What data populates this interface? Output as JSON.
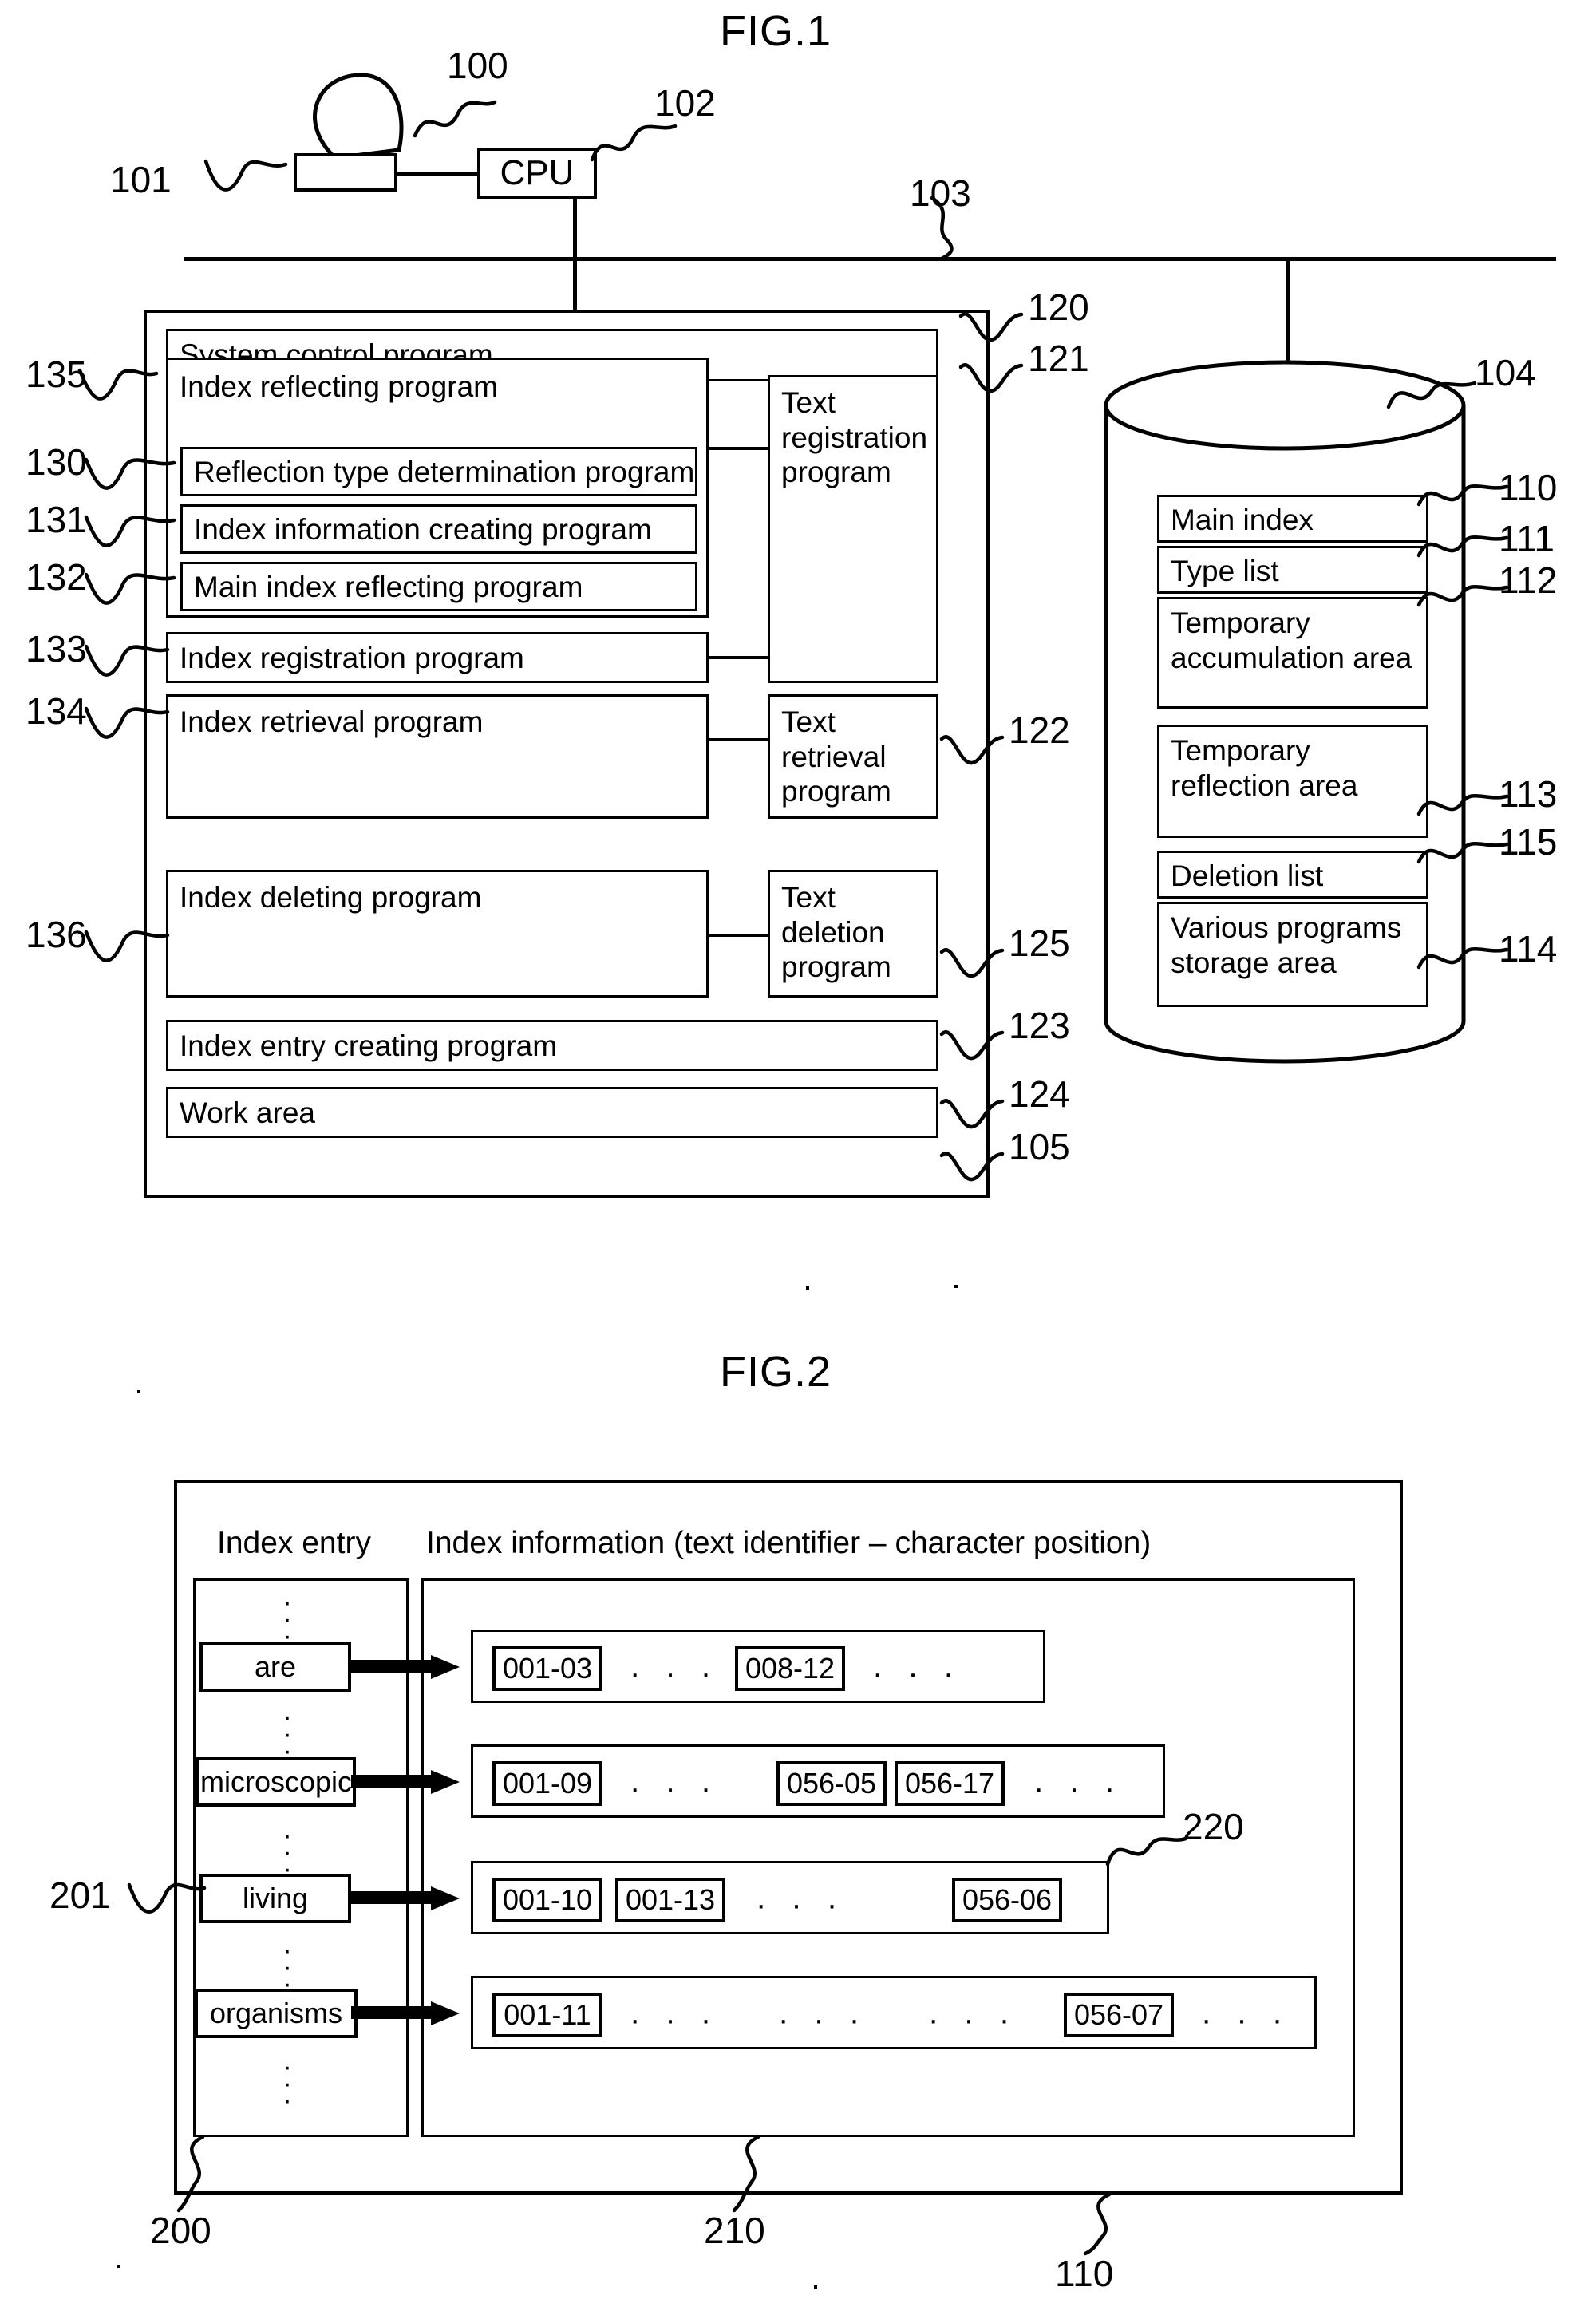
{
  "figures": [
    {
      "id": "fig1",
      "title": "FIG.1",
      "cpu_label": "CPU",
      "memory_blocks": {
        "system_control": "System control program",
        "index_reflecting": "Index reflecting program",
        "reflection_type": "Reflection type determination program",
        "index_info_creating": "Index information creating program",
        "main_index_reflecting": "Main index reflecting program",
        "index_registration": "Index registration program",
        "index_retrieval": "Index retrieval program",
        "index_deleting": "Index deleting program",
        "index_entry_creating": "Index entry creating program",
        "work_area": "Work area",
        "text_registration": "Text\nregistration\nprogram",
        "text_retrieval": "Text\nretrieval\nprogram",
        "text_deletion": "Text\ndeletion\nprogram"
      },
      "storage_blocks": {
        "main_index": "Main index",
        "type_list": "Type list",
        "temporary_accumulation": "Temporary\naccumulation area",
        "temporary_reflection": "Temporary\nreflection area",
        "deletion_list": "Deletion list",
        "various_programs": "Various programs\n storage area"
      },
      "reference_numerals": {
        "display": "100",
        "input_device": "101",
        "cpu": "102",
        "bus": "103",
        "storage": "104",
        "memory": "105",
        "main_index": "110",
        "type_list": "111",
        "temporary_accumulation": "112",
        "temporary_reflection": "113",
        "various_programs": "114",
        "deletion_list": "115",
        "system_control": "120",
        "text_registration": "121",
        "text_retrieval": "122",
        "index_entry_creating": "123",
        "work_area": "124",
        "text_deletion": "125",
        "reflection_type": "130",
        "index_info_creating": "131",
        "main_index_reflecting": "132",
        "index_registration": "133",
        "index_retrieval": "134",
        "index_reflecting": "135",
        "index_deleting": "136"
      }
    },
    {
      "id": "fig2",
      "title": "FIG.2",
      "column_headers": {
        "index_entry": "Index entry",
        "index_information": "Index information (text identifier – character position)"
      },
      "rows": [
        {
          "entry": "are",
          "cells": [
            "001-03",
            "· · ·",
            "008-12",
            "· · ·"
          ]
        },
        {
          "entry": "microscopic",
          "cells": [
            "001-09",
            "· · ·",
            "056-05",
            "056-17",
            "· · ·"
          ]
        },
        {
          "entry": "living",
          "cells": [
            "001-10",
            "001-13",
            "· · ·",
            "056-06"
          ]
        },
        {
          "entry": "organisms",
          "cells": [
            "001-11",
            "· · ·",
            "· · ·",
            "· · ·",
            "056-07",
            "· · ·"
          ]
        }
      ],
      "vertical_ellipsis": "·\n·\n·",
      "reference_numerals": {
        "index_entry_column": "200",
        "index_entry_item": "201",
        "index_information_column": "210",
        "index_information_row": "220",
        "main_index": "110"
      }
    }
  ]
}
